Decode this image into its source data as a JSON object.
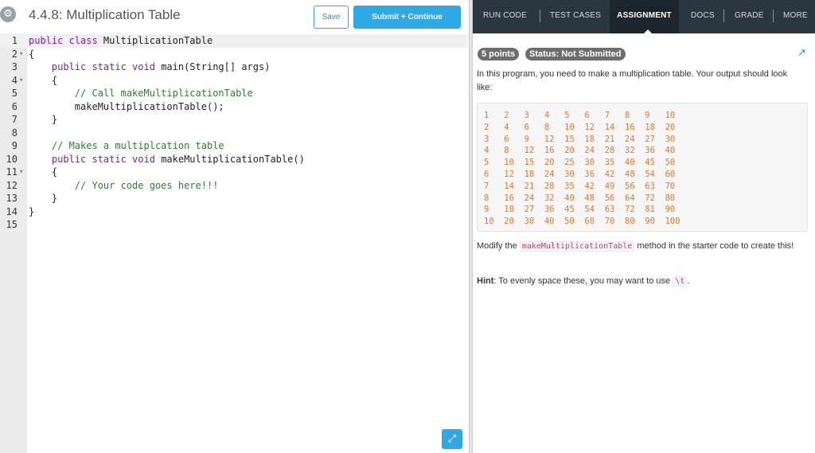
{
  "header": {
    "title": "4.4.8: Multiplication Table",
    "save_label": "Save",
    "submit_label": "Submit + Continue"
  },
  "editor": {
    "lines": [
      {
        "n": "1",
        "fold": "",
        "parts": [
          [
            "kw",
            "public class "
          ],
          [
            "",
            "MultiplicationTable"
          ]
        ]
      },
      {
        "n": "2",
        "fold": "▾",
        "parts": [
          [
            "",
            "{"
          ]
        ]
      },
      {
        "n": "3",
        "fold": "",
        "parts": [
          [
            "",
            "    "
          ],
          [
            "kw",
            "public static void "
          ],
          [
            "",
            "main(String[] args)"
          ]
        ]
      },
      {
        "n": "4",
        "fold": "▾",
        "parts": [
          [
            "",
            "    {"
          ]
        ]
      },
      {
        "n": "5",
        "fold": "",
        "parts": [
          [
            "",
            "        "
          ],
          [
            "cm",
            "// Call makeMultiplicationTable"
          ]
        ]
      },
      {
        "n": "6",
        "fold": "",
        "parts": [
          [
            "",
            "        makeMultiplicationTable();"
          ]
        ]
      },
      {
        "n": "7",
        "fold": "",
        "parts": [
          [
            "",
            "    }"
          ]
        ]
      },
      {
        "n": "8",
        "fold": "",
        "parts": [
          [
            "",
            ""
          ]
        ]
      },
      {
        "n": "9",
        "fold": "",
        "parts": [
          [
            "",
            "    "
          ],
          [
            "cm",
            "// Makes a multiplcation table"
          ]
        ]
      },
      {
        "n": "10",
        "fold": "",
        "parts": [
          [
            "",
            "    "
          ],
          [
            "kw",
            "public static void "
          ],
          [
            "",
            "makeMultiplicationTable()"
          ]
        ]
      },
      {
        "n": "11",
        "fold": "▾",
        "parts": [
          [
            "",
            "    {"
          ]
        ]
      },
      {
        "n": "12",
        "fold": "",
        "parts": [
          [
            "",
            "        "
          ],
          [
            "cm",
            "// Your code goes here!!!"
          ]
        ]
      },
      {
        "n": "13",
        "fold": "",
        "parts": [
          [
            "",
            "    }"
          ]
        ]
      },
      {
        "n": "14",
        "fold": "",
        "parts": [
          [
            "",
            "}"
          ]
        ]
      },
      {
        "n": "15",
        "fold": "",
        "parts": [
          [
            "",
            ""
          ]
        ]
      }
    ]
  },
  "tabs": {
    "run_code": "RUN CODE",
    "test_cases": "TEST CASES",
    "assignment": "ASSIGNMENT",
    "docs": "DOCS",
    "grade": "GRADE",
    "more": "MORE"
  },
  "assignment": {
    "points_badge": "5 points",
    "status_badge": "Status: Not Submitted",
    "intro": "In this program, you need to make a multiplication table. Your output should look like:",
    "output_lines": [
      "1   2   3   4   5   6   7   8   9   10",
      "2   4   6   8   10  12  14  16  18  20",
      "3   6   9   12  15  18  21  24  27  30",
      "4   8   12  16  20  24  28  32  36  40",
      "5   10  15  20  25  30  35  40  45  50",
      "6   12  18  24  30  36  42  48  54  60",
      "7   14  21  28  35  42  49  56  63  70",
      "8   16  24  32  40  48  56  64  72  80",
      "9   18  27  36  45  54  63  72  81  90",
      "10  20  30  40  50  60  70  80  90  100"
    ],
    "modify_before": "Modify the ",
    "modify_code": "makeMultiplicationTable",
    "modify_after": " method in the starter code to create this!",
    "hint_label": "Hint",
    "hint_text": ": To evenly space these, you may want to use ",
    "hint_code": "\\t",
    "hint_end": "."
  },
  "icons": {
    "settings": "gear-icon",
    "expand": "expand-icon",
    "external_link": "external-link-icon"
  }
}
